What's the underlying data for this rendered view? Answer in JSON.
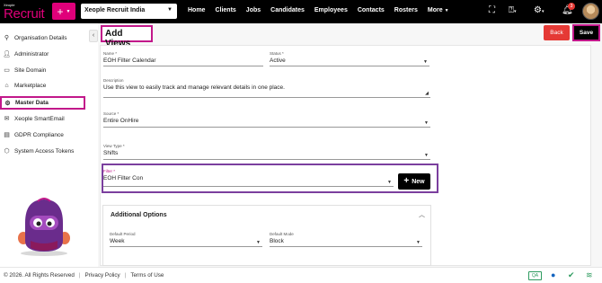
{
  "header": {
    "logo_small": "Xeople",
    "logo_main": "Recruit",
    "plus_label": "+",
    "environment": "Xeople Recruit India",
    "nav": [
      "Home",
      "Clients",
      "Jobs",
      "Candidates",
      "Employees",
      "Contacts",
      "Rosters",
      "More"
    ],
    "notification_count": "3",
    "icons": [
      "fullscreen-icon",
      "help-icon",
      "settings-icon",
      "bell-icon"
    ]
  },
  "sidebar": {
    "items": [
      {
        "label": "Organisation Details",
        "icon": "organisation-icon"
      },
      {
        "label": "Administrator",
        "icon": "user-icon"
      },
      {
        "label": "Site Domain",
        "icon": "domain-icon"
      },
      {
        "label": "Marketplace",
        "icon": "marketplace-icon"
      },
      {
        "label": "Master Data",
        "icon": "master-data-icon",
        "active": true
      },
      {
        "label": "Xeople SmartEmail",
        "icon": "email-icon"
      },
      {
        "label": "GDPR Compliance",
        "icon": "gdpr-icon"
      },
      {
        "label": "System Access Tokens",
        "icon": "token-icon"
      }
    ]
  },
  "page": {
    "title": "Add Views",
    "back_label": "Back",
    "save_label": "Save"
  },
  "form": {
    "name": {
      "label": "Name *",
      "value": "EOH Filter Calendar"
    },
    "status": {
      "label": "Status *",
      "value": "Active"
    },
    "description": {
      "label": "Description",
      "value": "Use this view to easily track and manage relevant details in one place."
    },
    "source": {
      "label": "Source *",
      "value": "Entire OnHire"
    },
    "view_type": {
      "label": "View Type *",
      "value": "Shifts"
    },
    "filter": {
      "label": "Filter *",
      "value": "EOH Filter Con"
    },
    "new_label": "New"
  },
  "additional_options": {
    "title": "Additional Options",
    "default_period": {
      "label": "Default Period",
      "value": "Week"
    },
    "default_mode": {
      "label": "Default Mode",
      "value": "Block"
    }
  },
  "footer": {
    "copyright": "© 2026. All Rights Reserved",
    "privacy": "Privacy Policy",
    "terms": "Terms of Use",
    "qa": "QA"
  },
  "colors": {
    "accent": "#e0007a",
    "highlight": "#c2188a",
    "filter_border": "#7b3f9e",
    "back_button": "#e53935"
  }
}
